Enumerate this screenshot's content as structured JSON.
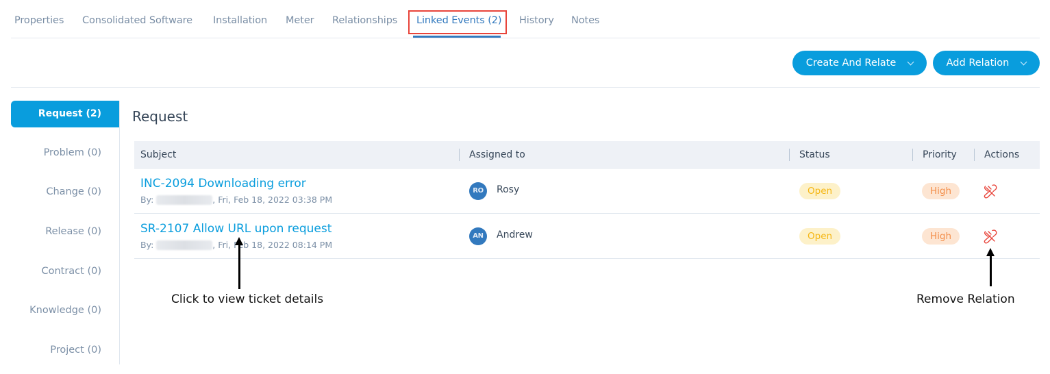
{
  "tabs": [
    {
      "label": "Properties",
      "active": false
    },
    {
      "label": "Consolidated Software",
      "active": false
    },
    {
      "label": "Installation",
      "active": false
    },
    {
      "label": "Meter",
      "active": false
    },
    {
      "label": "Relationships",
      "active": false
    },
    {
      "label": "Linked Events (2)",
      "active": true
    },
    {
      "label": "History",
      "active": false
    },
    {
      "label": "Notes",
      "active": false
    }
  ],
  "toolbar": {
    "create_and_relate_label": "Create And Relate",
    "add_relation_label": "Add Relation"
  },
  "sidebar": {
    "items": [
      {
        "label": "Request (2)",
        "active": true
      },
      {
        "label": "Problem (0)",
        "active": false
      },
      {
        "label": "Change (0)",
        "active": false
      },
      {
        "label": "Release (0)",
        "active": false
      },
      {
        "label": "Contract (0)",
        "active": false
      },
      {
        "label": "Knowledge (0)",
        "active": false
      },
      {
        "label": "Project (0)",
        "active": false
      }
    ]
  },
  "section": {
    "title": "Request"
  },
  "table": {
    "columns": [
      "Subject",
      "Assigned to",
      "Status",
      "Priority",
      "Actions"
    ],
    "rows": [
      {
        "subject": "INC-2094 Downloading error",
        "by_prefix": "By:",
        "date": ", Fri, Feb 18, 2022 03:38 PM",
        "assignee_initials": "RO",
        "assignee": "Rosy",
        "status": "Open",
        "priority": "High",
        "action_icon": "unlink-icon"
      },
      {
        "subject": "SR-2107 Allow URL upon request",
        "by_prefix": "By:",
        "date": ", Fri, Feb 18, 2022 08:14 PM",
        "assignee_initials": "AN",
        "assignee": "Andrew",
        "status": "Open",
        "priority": "High",
        "action_icon": "unlink-icon"
      }
    ]
  },
  "annotations": {
    "ticket_details": "Click to view ticket details",
    "remove_relation": "Remove Relation"
  },
  "colors": {
    "accent": "#099ddd",
    "tab_active": "#3279be",
    "highlight_box": "#e8443a",
    "status_open_text": "#f5b614",
    "status_open_bg": "#fdf1c9",
    "priority_high_text": "#f38e4a",
    "priority_high_bg": "#fde5d2",
    "remove_icon": "#e8443a"
  }
}
